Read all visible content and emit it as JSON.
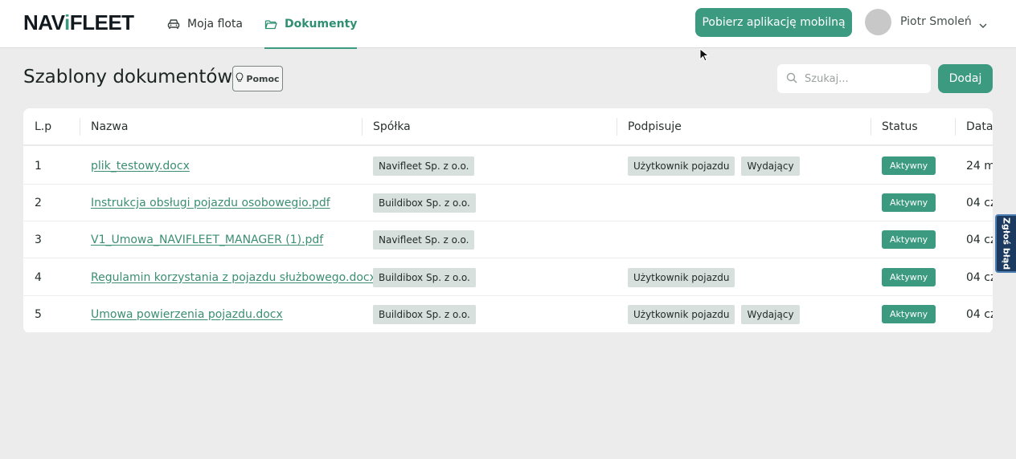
{
  "brand": {
    "logo_prefix": "NAV",
    "logo_accent": "i",
    "logo_suffix": "FLEET"
  },
  "nav": {
    "items": [
      {
        "label": "Moja flota",
        "icon": "car-icon",
        "active": false
      },
      {
        "label": "Dokumenty",
        "icon": "folder-icon",
        "active": true
      }
    ]
  },
  "header": {
    "app_button": "Pobierz aplikację mobilną",
    "user_name": "Piotr Smoleń"
  },
  "page": {
    "title": "Szablony dokumentów",
    "help_label": "Pomoc",
    "search_placeholder": "Szukaj...",
    "add_label": "Dodaj"
  },
  "table": {
    "columns": [
      "L.p",
      "Nazwa",
      "Spółka",
      "Podpisuje",
      "Status",
      "Data"
    ],
    "rows": [
      {
        "lp": "1",
        "name": "plik_testowy.docx",
        "company": "Navifleet Sp. z o.o.",
        "signers": [
          "Użytkownik pojazdu",
          "Wydający"
        ],
        "status": "Aktywny",
        "date": "24 m"
      },
      {
        "lp": "2",
        "name": "Instrukcja obsługi pojazdu osobowegio.pdf",
        "company": "Buildibox Sp. z o.o.",
        "signers": [],
        "status": "Aktywny",
        "date": "04 cz"
      },
      {
        "lp": "3",
        "name": "V1_Umowa_NAVIFLEET_MANAGER (1).pdf",
        "company": "Navifleet Sp. z o.o.",
        "signers": [],
        "status": "Aktywny",
        "date": "04 cz"
      },
      {
        "lp": "4",
        "name": "Regulamin korzystania z pojazdu służbowego.docx",
        "company": "Buildibox Sp. z o.o.",
        "signers": [
          "Użytkownik pojazdu"
        ],
        "status": "Aktywny",
        "date": "04 cz"
      },
      {
        "lp": "5",
        "name": "Umowa powierzenia pojazdu.docx",
        "company": "Buildibox Sp. z o.o.",
        "signers": [
          "Użytkownik pojazdu",
          "Wydający"
        ],
        "status": "Aktywny",
        "date": "04 cz"
      }
    ]
  },
  "feedback_tab": "Zgłoś błąd",
  "colors": {
    "accent": "#3b9a7f",
    "feedback": "#1c3a5f"
  }
}
